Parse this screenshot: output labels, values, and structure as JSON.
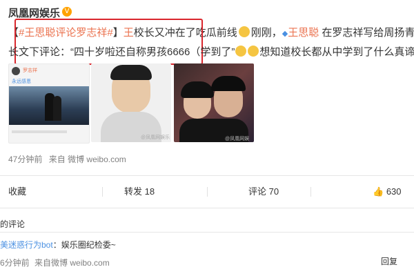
{
  "post": {
    "author": "凤凰网娱乐",
    "verified_badge": "V",
    "topic": "#王思聪评论罗志祥#",
    "text_a": "【",
    "text_b": "】",
    "mention_name": "王",
    "text_c": "校长又冲在了吃瓜前线",
    "text_d": "刚刚，",
    "mention_name2": "王思聪",
    "text_e": " 在罗志祥写给周扬青",
    "line2_a": "长文下评论：“四十岁啦还自称男孩6666（学到了”",
    "line2_b": "想知道校长都从中学到了什么真谛",
    "timestamp": "47分钟前",
    "source_prefix": "来自",
    "source": "微博 weibo.com"
  },
  "images": {
    "img1_username": "罗志祥",
    "img1_caption": "永远感恩",
    "img2_watermark": "@凤凰网娱乐",
    "img3_watermark": "@凤凰网娱乐"
  },
  "actions": {
    "favorite": "收藏",
    "repost": "转发 18",
    "comment": "评论 70",
    "like": "630"
  },
  "comments": {
    "section_title": "的评论",
    "commenter": "美迷惑行为bot",
    "comment_text": "：娱乐圈纪检委~",
    "comment_time": "6分钟前",
    "comment_source": "来自微博 weibo.com",
    "reply": "回复"
  },
  "colors": {
    "highlight": "#d9262c",
    "link": "#eb7350",
    "verified": "#ffa200"
  }
}
